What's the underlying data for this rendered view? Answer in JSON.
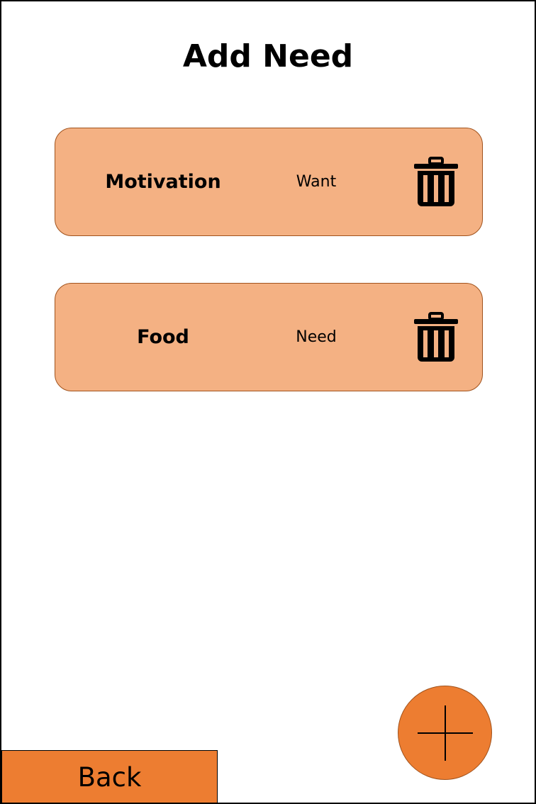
{
  "header": {
    "title": "Add Need"
  },
  "needs": [
    {
      "name": "Motivation",
      "type": "Want",
      "delete_icon": "trash-icon"
    },
    {
      "name": "Food",
      "type": "Need",
      "delete_icon": "trash-icon"
    }
  ],
  "actions": {
    "add_icon": "plus-icon",
    "back_label": "Back"
  },
  "colors": {
    "card_fill": "#f4b183",
    "card_border": "#a0521c",
    "accent": "#ed7d31",
    "text": "#000000",
    "background": "#ffffff"
  }
}
